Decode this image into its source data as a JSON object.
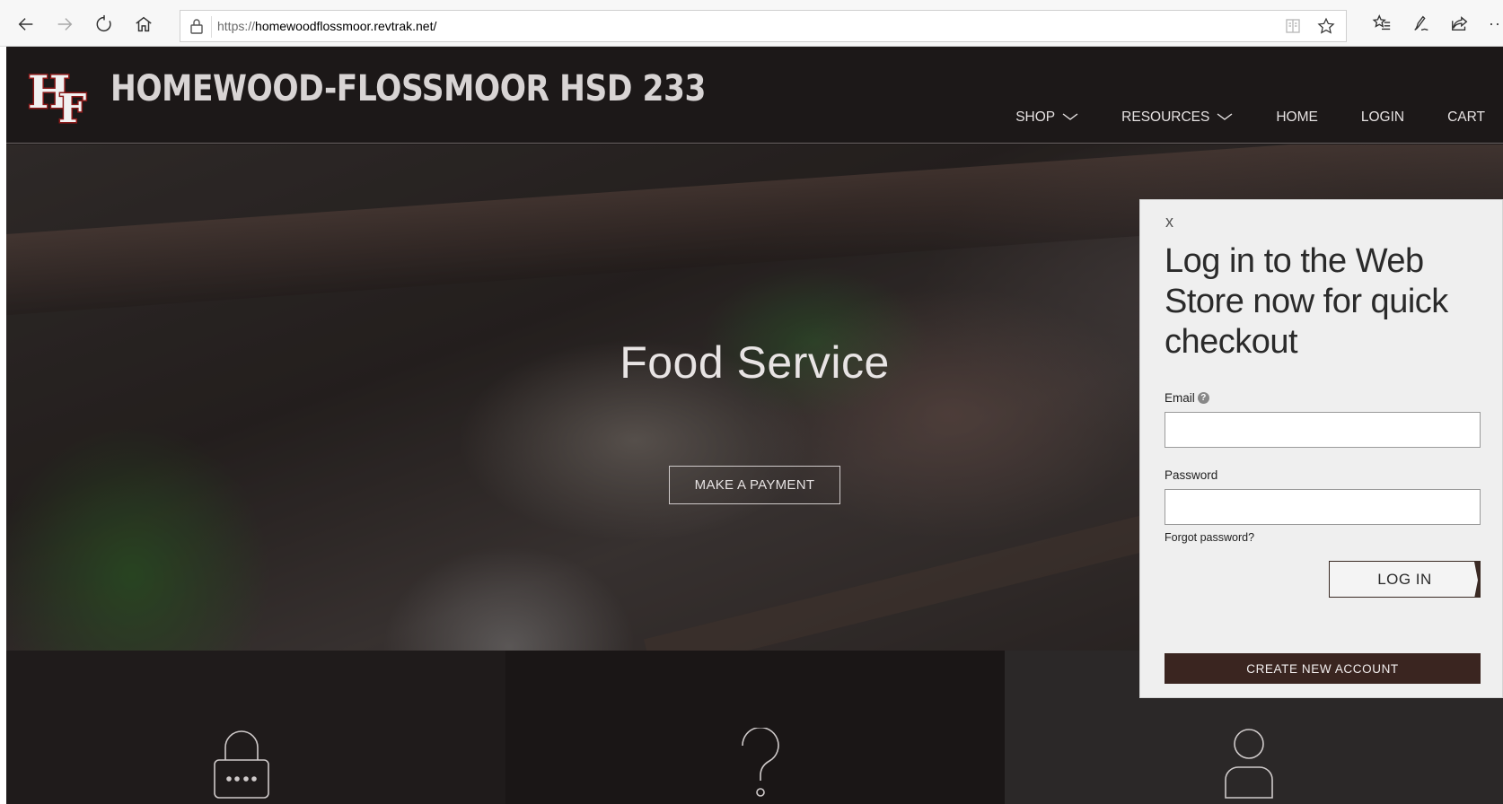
{
  "browser": {
    "url_scheme": "https://",
    "url_host": "homewoodflossmoor.revtrak.net/",
    "more_label": "···"
  },
  "header": {
    "logo_letters": "HF",
    "school_name": "HOMEWOOD-FLOSSMOOR HSD 233",
    "nav": [
      {
        "label": "SHOP",
        "has_dropdown": true
      },
      {
        "label": "RESOURCES",
        "has_dropdown": true
      },
      {
        "label": "HOME",
        "has_dropdown": false
      },
      {
        "label": "LOGIN",
        "has_dropdown": false
      },
      {
        "label": "CART",
        "has_dropdown": false
      }
    ]
  },
  "hero": {
    "title": "Food Service",
    "button_label": "MAKE A PAYMENT"
  },
  "tiles": [
    {
      "icon": "lock-icon"
    },
    {
      "icon": "question-mark-icon"
    },
    {
      "icon": "user-icon"
    }
  ],
  "login": {
    "close_label": "x",
    "heading": "Log in to the Web Store now for quick checkout",
    "email_label": "Email",
    "email_value": "",
    "password_label": "Password",
    "password_value": "",
    "forgot_label": "Forgot password?",
    "login_button": "LOG IN",
    "create_button": "CREATE NEW ACCOUNT"
  },
  "colors": {
    "header_bg": "#1c1818",
    "accent_brown": "#3a2520",
    "panel_bg": "#efefef",
    "logo_maroon": "#8b1a1a"
  }
}
